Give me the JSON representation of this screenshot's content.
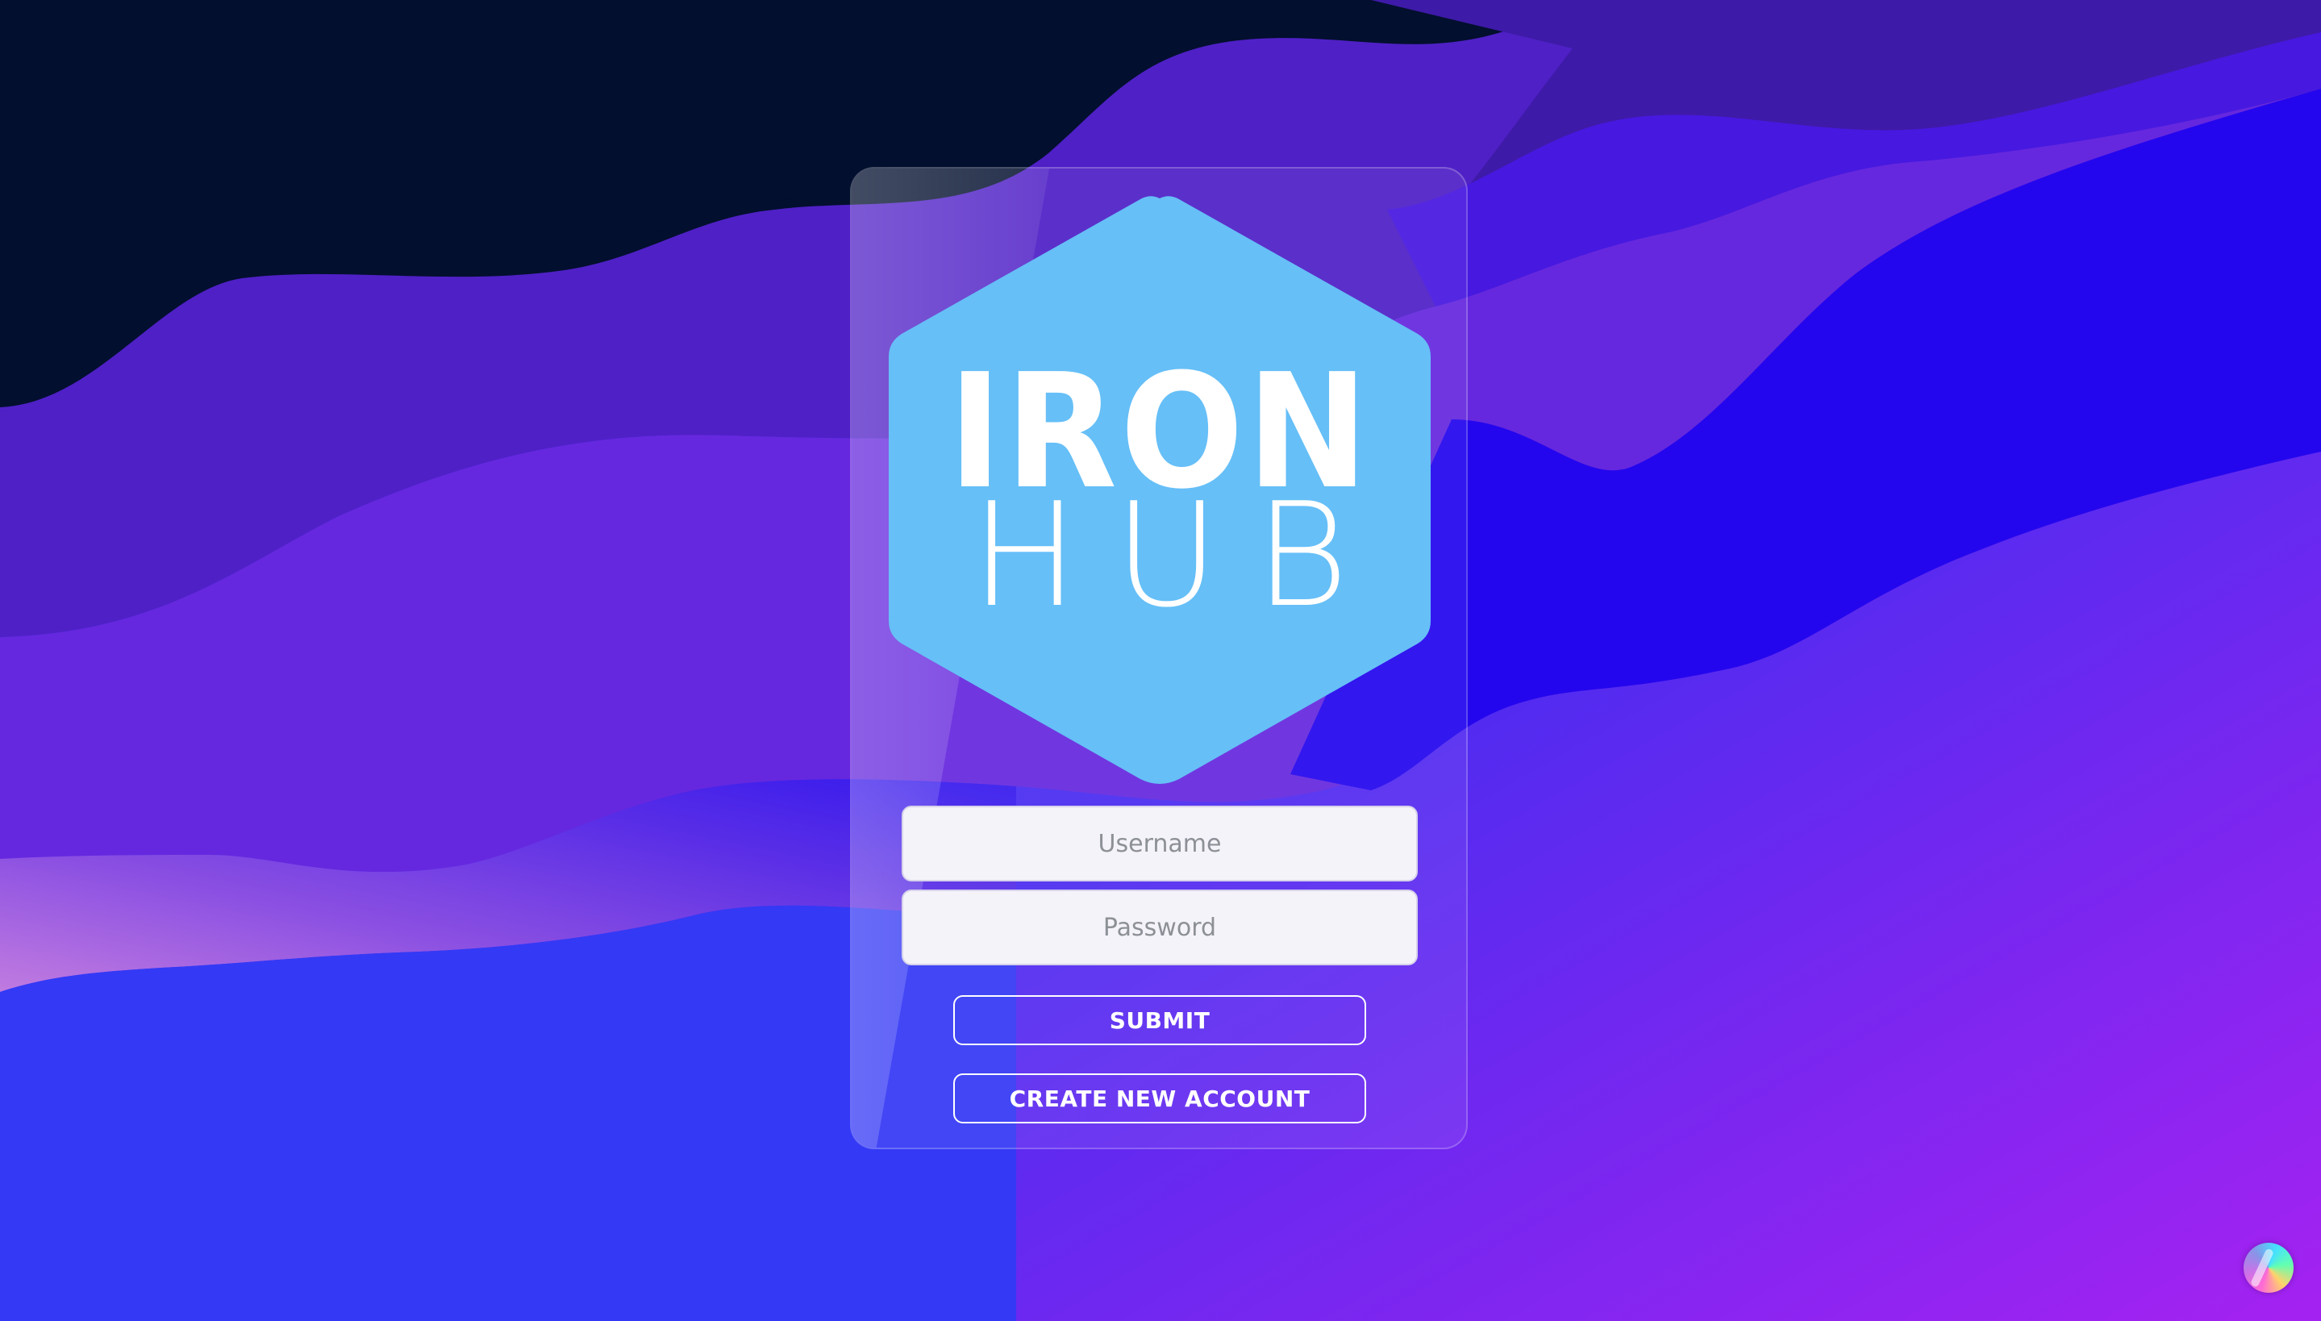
{
  "brand": {
    "logo_line1": "IRON",
    "logo_line2": "HUB",
    "logo_color": "#66bff7"
  },
  "login_form": {
    "username_placeholder": "Username",
    "password_placeholder": "Password",
    "submit_label": "SUBMIT",
    "create_account_label": "CREATE NEW ACCOUNT"
  },
  "colors": {
    "background_top_dark": "#020f2e",
    "wave_purple": "#5a24d6",
    "wave_blue": "#2a05f0",
    "background_bottom_magenta": "#a722f2",
    "input_background": "#f5f3fa",
    "button_border": "#ffffff"
  },
  "icons": {
    "corner_orb": "color-orb-icon"
  }
}
